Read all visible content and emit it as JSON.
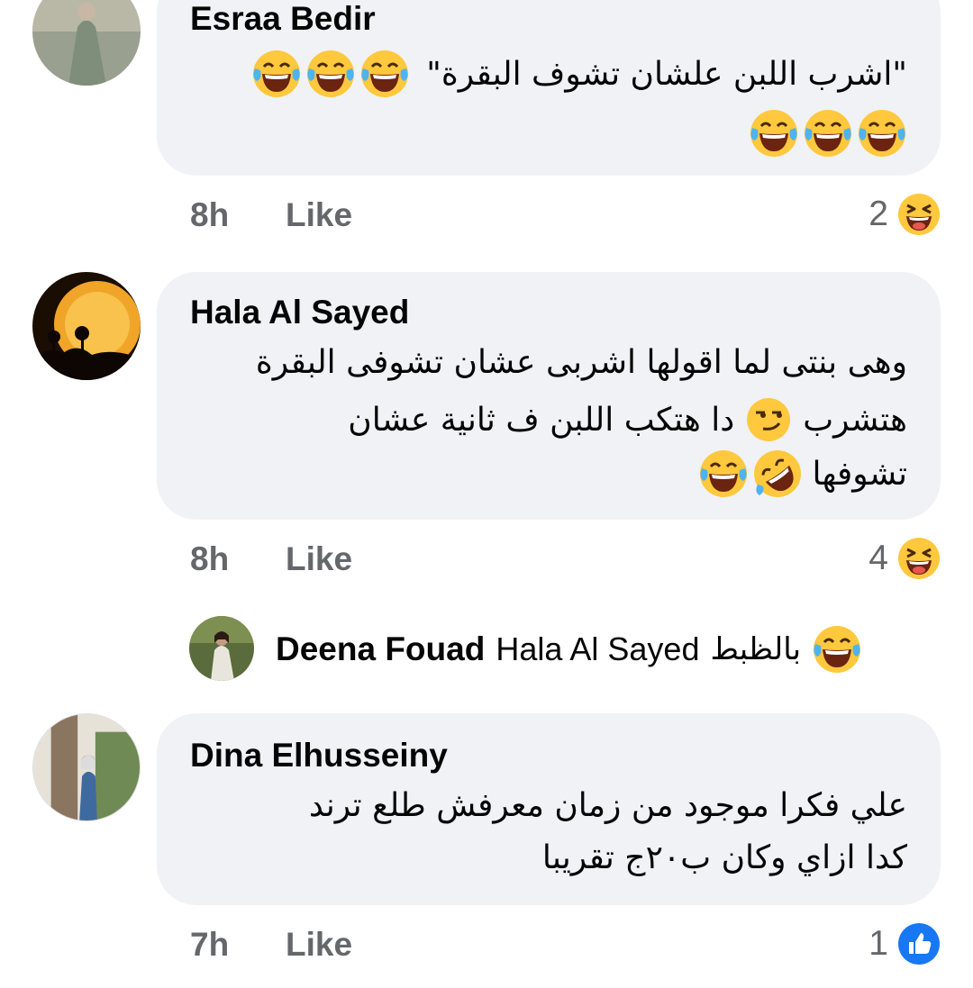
{
  "comments": [
    {
      "author": "Esraa Bedir",
      "lines": [
        "\"اشرب اللبن علشان تشوف البقرة\""
      ],
      "time": "8h",
      "like_label": "Like",
      "reaction_count": "2",
      "reaction_icon": "laughing-face-icon"
    },
    {
      "author": "Hala Al Sayed",
      "lines": [
        "وهى بنتى لما اقولها اشربى عشان تشوفى البقرة",
        "هتشرب",
        "دا هتكب اللبن ف ثانية عشان",
        "تشوفها"
      ],
      "time": "8h",
      "like_label": "Like",
      "reaction_count": "4",
      "reaction_icon": "laughing-face-icon"
    },
    {
      "author": "Dina Elhusseiny",
      "lines": [
        "علي فكرا موجود من زمان معرفش طلع ترند",
        "كدا ازاي وكان ب٢٠ج تقريبا"
      ],
      "time": "7h",
      "like_label": "Like",
      "reaction_count": "1",
      "reaction_icon": "like-thumb-icon"
    }
  ],
  "reply": {
    "author": "Deena Fouad",
    "mention": "Hala Al Sayed",
    "text": "بالظبط"
  },
  "colors": {
    "bubble_bg": "#f0f2f5",
    "meta_text": "#65676b",
    "like_blue": "#1877f2",
    "emoji_yellow": "#ffc83d"
  }
}
